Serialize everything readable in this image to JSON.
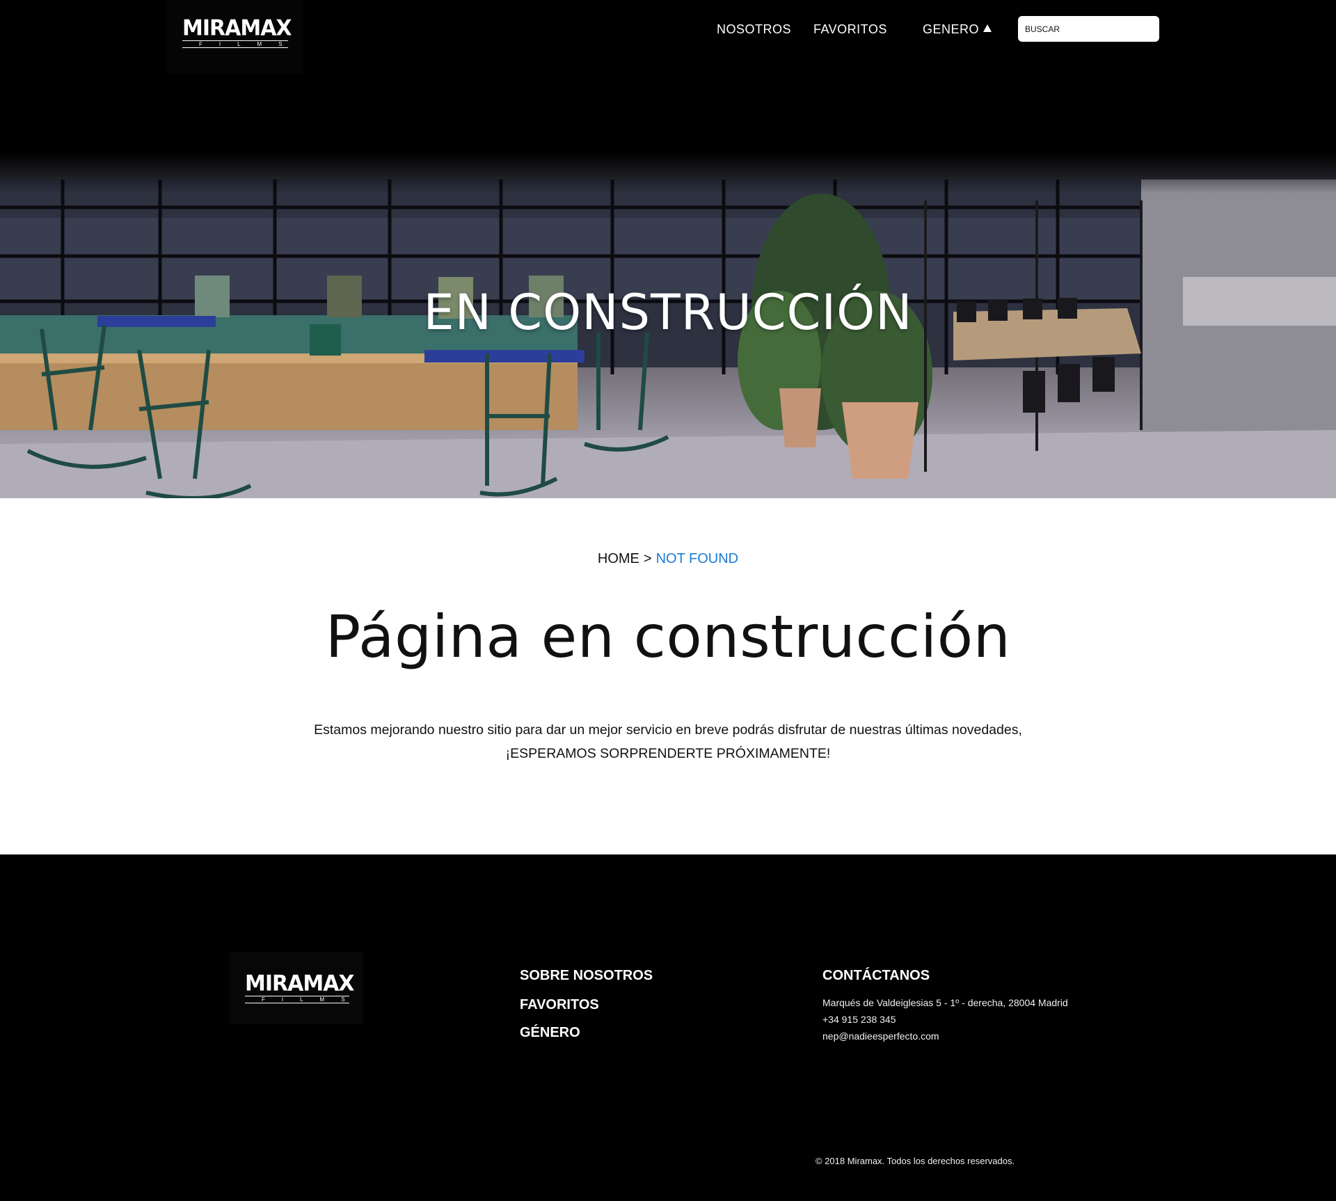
{
  "header": {
    "logo": {
      "main": "MIRAMAX",
      "sub": "FILMS"
    },
    "nav": [
      {
        "label": "NOSOTROS"
      },
      {
        "label": "FAVORITOS"
      },
      {
        "label": "GENERO"
      }
    ],
    "search": {
      "placeholder": "BUSCAR",
      "value": ""
    }
  },
  "hero": {
    "title": "EN CONSTRUCCIÓN"
  },
  "breadcrumb": {
    "home": "HOME",
    "separator": ">",
    "current": "NOT FOUND"
  },
  "main": {
    "title": "Página en construcción",
    "message_line1": "Estamos mejorando nuestro sitio para dar un mejor servicio en breve podrás disfrutar de nuestras últimas novedades,",
    "message_line2": "¡ESPERAMOS SORPRENDERTE PRÓXIMAMENTE!"
  },
  "footer": {
    "logo": {
      "main": "MIRAMAX",
      "sub": "FILMS"
    },
    "links": [
      {
        "label": "SOBRE NOSOTROS"
      },
      {
        "label": "FAVORITOS"
      },
      {
        "label": "GÉNERO"
      }
    ],
    "contact": {
      "title": "CONTÁCTANOS",
      "address": "Marqués de Valdeiglesias 5 - 1º - derecha, 28004 Madrid",
      "phone": "+34 915 238 345",
      "email": "nep@nadieesperfecto.com"
    },
    "copyright": "© 2018 Miramax. Todos los derechos reservados."
  },
  "colors": {
    "background": "#000000",
    "accent": "#1a7bd6",
    "text": "#111111"
  },
  "icons": {
    "genero_caret": "caret-up-icon"
  }
}
